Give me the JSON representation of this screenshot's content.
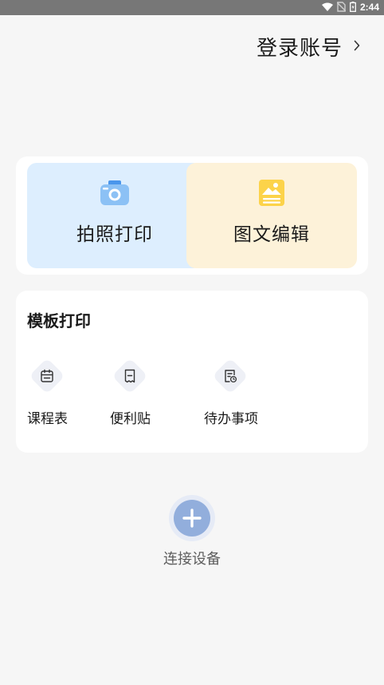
{
  "status_bar": {
    "time": "2:44",
    "icons": [
      "wifi-icon",
      "no-sim-icon",
      "battery-icon"
    ]
  },
  "header": {
    "login_label": "登录账号",
    "chevron": "chevron-right-icon"
  },
  "quick_actions": [
    {
      "label": "拍照打印",
      "icon": "camera-icon",
      "color": "#ddeefe"
    },
    {
      "label": "图文编辑",
      "icon": "image-edit-icon",
      "color": "#fdf2d9"
    }
  ],
  "templates": {
    "title": "模板打印",
    "items": [
      {
        "label": "课程表",
        "icon": "calendar-icon"
      },
      {
        "label": "便利贴",
        "icon": "sticky-note-icon"
      },
      {
        "label": "待办事项",
        "icon": "todo-list-icon"
      }
    ]
  },
  "device": {
    "connect_label": "连接设备",
    "icon": "plus-icon",
    "color": "#92aedc"
  }
}
